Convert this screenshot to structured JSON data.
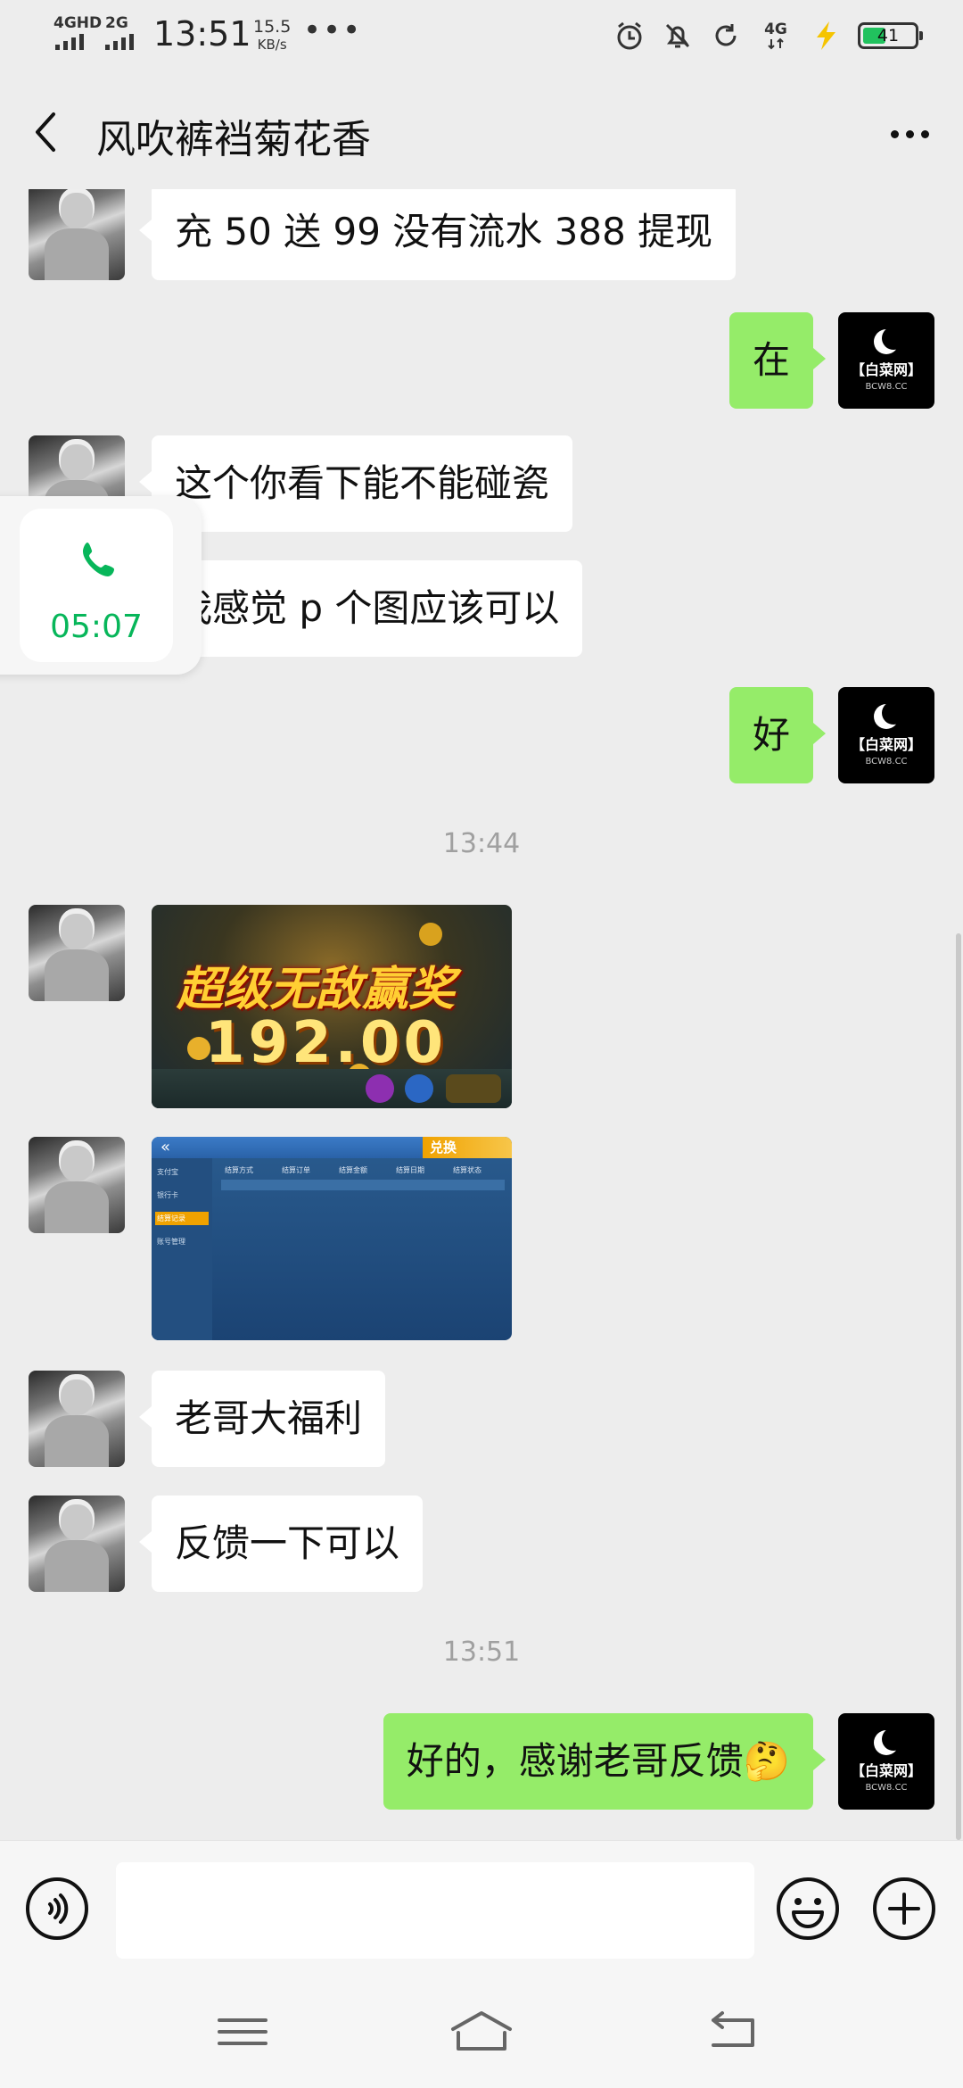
{
  "status": {
    "net1": "4GHD",
    "net2": "2G",
    "time": "13:51",
    "speed_value": "15.5",
    "speed_unit": "KB/s",
    "more": "•••",
    "net_right": "4G",
    "battery": "41",
    "battery_color": "#21c25e"
  },
  "header": {
    "title": "风吹裤裆菊花香"
  },
  "messages": {
    "m1": "充 50 送 99 没有流水 388 提现",
    "m2": "在",
    "m3": "这个你看下能不能碰瓷",
    "m4": "我感觉 p 个图应该可以",
    "m5": "好",
    "ts1": "13:44",
    "m8": "老哥大福利",
    "m9": "反馈一下可以",
    "ts2": "13:51",
    "m10": "好的，感谢老哥反馈🤔"
  },
  "self_avatar": {
    "brand": "【白菜网】",
    "site": "BCW8.CC"
  },
  "image1": {
    "line1": "超级无敌赢奖",
    "line2": "192.00"
  },
  "image2": {
    "badge": "兑换",
    "side_items": [
      "支付宝",
      "银行卡",
      "结算记录",
      "账号管理"
    ],
    "columns": [
      "结算方式",
      "结算订单",
      "结算金额",
      "结算日期",
      "结算状态"
    ]
  },
  "call": {
    "duration": "05:07",
    "accent": "#07b65a"
  },
  "input": {
    "placeholder": ""
  },
  "colors": {
    "bubble_self": "#95ec69",
    "bubble_other": "#ffffff",
    "background": "#ededed"
  }
}
